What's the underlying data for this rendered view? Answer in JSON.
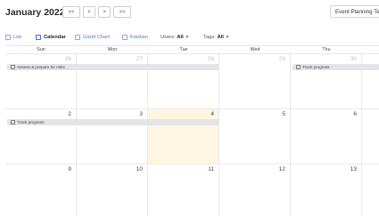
{
  "header": {
    "month_title": "January 2022",
    "nav": [
      "<<",
      "<",
      ">",
      ">>"
    ],
    "template_label": "Event Planning Template"
  },
  "views": [
    {
      "label": "List",
      "icon": "list-icon"
    },
    {
      "label": "Calendar",
      "icon": "calendar-icon"
    },
    {
      "label": "Gantt Chart",
      "icon": "gantt-icon"
    },
    {
      "label": "Kanban",
      "icon": "kanban-icon"
    }
  ],
  "filters": {
    "users_label": "Users:",
    "users_value": "All",
    "tags_label": "Tags:",
    "tags_value": "All"
  },
  "weekdays": [
    "Sun",
    "Mon",
    "Tue",
    "Wed",
    "Thu"
  ],
  "weeks": [
    {
      "days": [
        "26",
        "27",
        "28",
        "29",
        "30"
      ]
    },
    {
      "days": [
        "2",
        "3",
        "4",
        "5",
        "6"
      ]
    },
    {
      "days": [
        "9",
        "10",
        "11",
        "12",
        "13"
      ]
    }
  ],
  "events": {
    "assess": "Assess & prepare for risks",
    "track1": "Track progress",
    "track2": "Track progress"
  },
  "colors": {
    "accent": "#4a7bd0",
    "today": "#fdf6e0",
    "event_bar": "#e2e4e7"
  }
}
